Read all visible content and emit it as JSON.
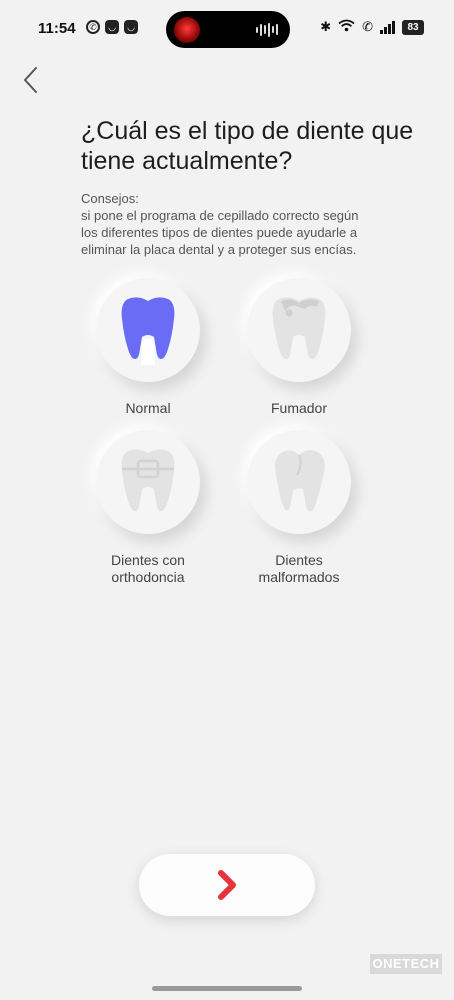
{
  "status_bar": {
    "time": "11:54",
    "battery": "83",
    "notification_icons": [
      "whatsapp-icon",
      "shopping-bag-icon",
      "shopping-bag-icon"
    ],
    "system_icons": [
      "bluetooth-icon",
      "wifi-icon",
      "call-icon",
      "signal-icon",
      "battery-icon"
    ]
  },
  "header": {
    "back_icon": "chevron-left-icon"
  },
  "main": {
    "title": "¿Cuál es el tipo de diente que tiene actualmente?",
    "tips_heading": "Consejos:",
    "tips_body": " si pone el programa de cepillado correcto según\nlos diferentes tipos de dientes puede ayudarle a\neliminar la placa dental y a proteger sus encías.",
    "options": [
      {
        "label": "Normal",
        "icon": "tooth-icon",
        "selected": true
      },
      {
        "label": "Fumador",
        "icon": "smoker-tooth-icon",
        "selected": false
      },
      {
        "label": "Dientes con\northodoncia",
        "icon": "braces-tooth-icon",
        "selected": false
      },
      {
        "label": "Dientes\nmalformados",
        "icon": "malformed-tooth-icon",
        "selected": false
      }
    ],
    "next_icon": "chevron-right-icon"
  },
  "colors": {
    "accent_selected": "#6b6cf6",
    "unselected_icon": "#e3e3e3",
    "next_arrow": "#e8323c",
    "background": "#f2f2f2"
  },
  "watermark": "ONETECH"
}
